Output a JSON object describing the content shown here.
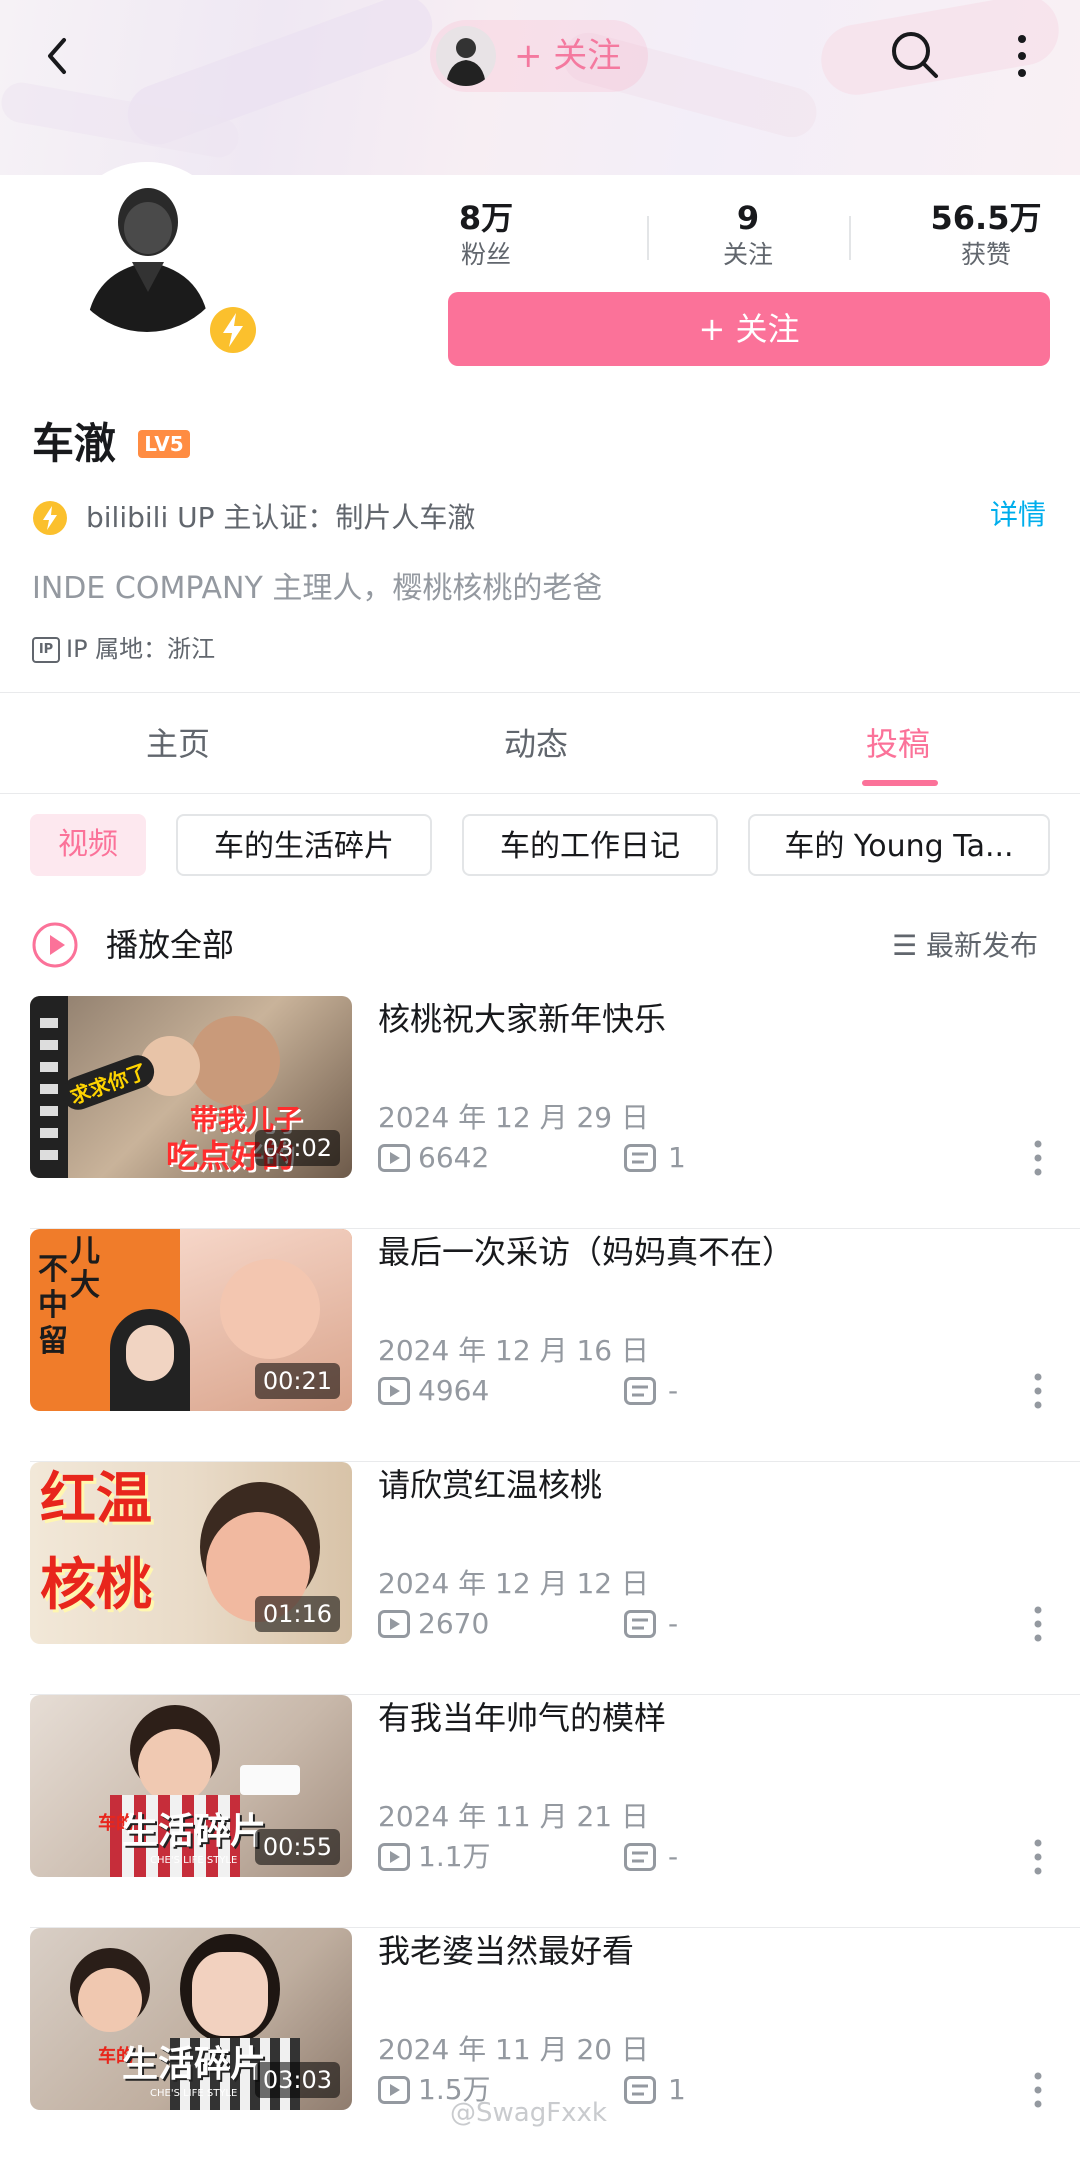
{
  "header": {
    "follow_label": "+ 关注"
  },
  "profile": {
    "stats": [
      {
        "value": "8万",
        "label": "粉丝"
      },
      {
        "value": "9",
        "label": "关注"
      },
      {
        "value": "56.5万",
        "label": "获赞"
      }
    ],
    "follow_button": "+ 关注",
    "name": "车澈",
    "level": "LV5",
    "certification": "bilibili UP 主认证：制片人车澈",
    "detail_link": "详情",
    "bio": "INDE COMPANY 主理人，樱桃核桃的老爸",
    "ip_badge": "IP",
    "ip_location": "IP 属地：浙江"
  },
  "tabs": [
    {
      "label": "主页",
      "active": false
    },
    {
      "label": "动态",
      "active": false
    },
    {
      "label": "投稿",
      "active": true
    }
  ],
  "chips": [
    {
      "label": "视频",
      "active": true
    },
    {
      "label": "车的生活碎片",
      "active": false
    },
    {
      "label": "车的工作日记",
      "active": false
    },
    {
      "label": "车的 Young Ta...",
      "active": false
    }
  ],
  "list_header": {
    "play_all": "播放全部",
    "sort": "☰ 最新发布"
  },
  "videos": [
    {
      "title": "核桃祝大家新年快乐",
      "date": "2024 年 12 月 29 日",
      "plays": "6642",
      "danmaku": "1",
      "duration": "03:02",
      "thumb_text": [
        "带我儿子",
        "吃点好的"
      ],
      "thumb_sticker": "求求你了"
    },
    {
      "title": "最后一次采访（妈妈真不在）",
      "date": "2024 年 12 月 16 日",
      "plays": "4964",
      "danmaku": "-",
      "duration": "00:21",
      "thumb_text": [
        "不",
        "中",
        "留"
      ],
      "thumb_text2": [
        "儿",
        "大"
      ]
    },
    {
      "title": "请欣赏红温核桃",
      "date": "2024 年 12 月 12 日",
      "plays": "2670",
      "danmaku": "-",
      "duration": "01:16",
      "thumb_text": [
        "红温",
        "核桃"
      ]
    },
    {
      "title": "有我当年帅气的模样",
      "date": "2024 年 11 月 21 日",
      "plays": "1.1万",
      "danmaku": "-",
      "duration": "00:55",
      "thumb_text": [
        "车的",
        "生活碎片"
      ],
      "thumb_sub": "CHE'S LIFE STYLE"
    },
    {
      "title": "我老婆当然最好看",
      "date": "2024 年 11 月 20 日",
      "plays": "1.5万",
      "danmaku": "1",
      "duration": "03:03",
      "thumb_text": [
        "车的",
        "生活碎片"
      ],
      "thumb_sub": "CHE'S LIFE STYLE"
    }
  ],
  "watermark": "@SwagFxxk",
  "colors": {
    "accent": "#fb7299",
    "link": "#00aeec",
    "verify": "#fbc02d",
    "level": "#ff8c42"
  }
}
